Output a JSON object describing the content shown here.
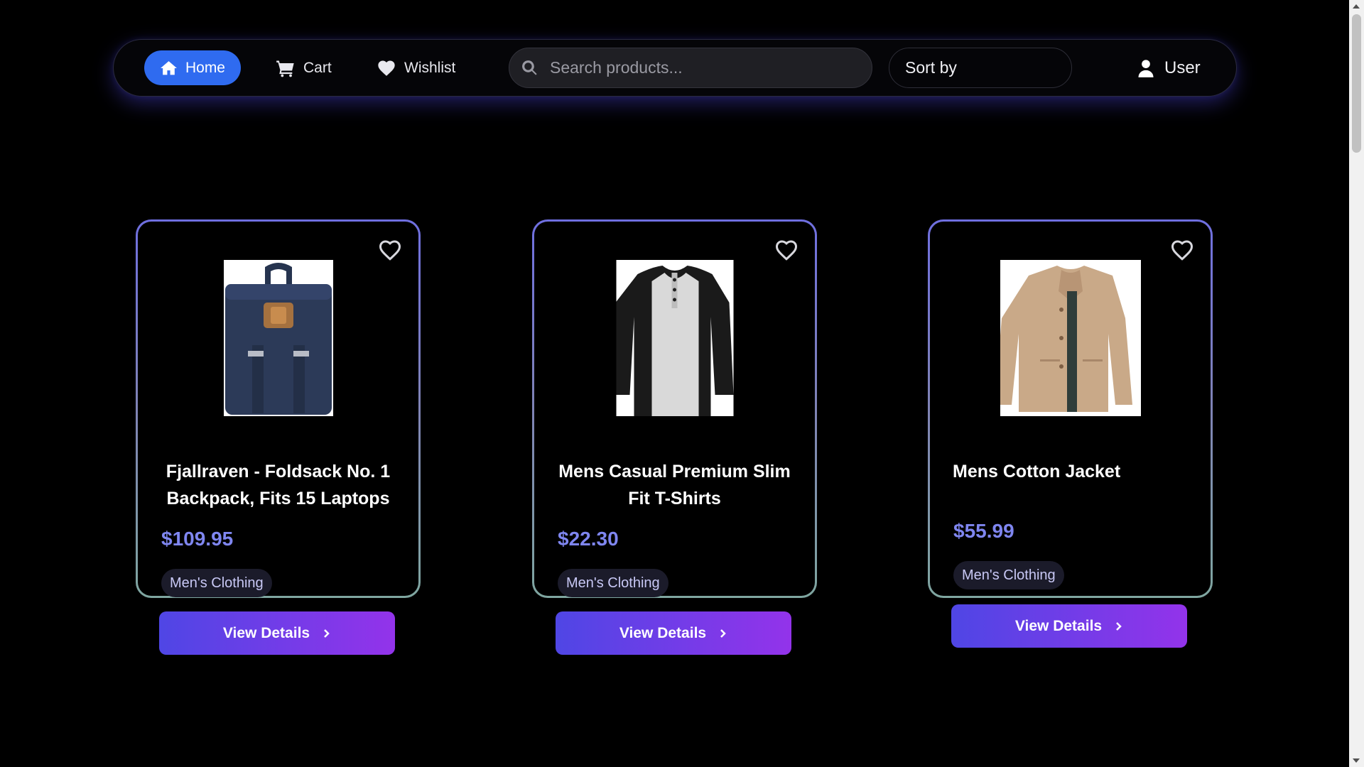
{
  "nav": {
    "home_label": "Home",
    "cart_label": "Cart",
    "wishlist_label": "Wishlist",
    "search_placeholder": "Search products...",
    "sort_label": "Sort by",
    "user_label": "User",
    "active_color": "#2f6bf0"
  },
  "products": [
    {
      "title": "Fjallraven - Foldsack No. 1 Backpack, Fits 15 Laptops",
      "price": "$109.95",
      "category": "Men's Clothing",
      "image": "backpack",
      "button": "View Details"
    },
    {
      "title": "Mens Casual Premium Slim Fit T-Shirts",
      "price": "$22.30",
      "category": "Men's Clothing",
      "image": "raglan-henley-shirt",
      "button": "View Details"
    },
    {
      "title": "Mens Cotton Jacket",
      "price": "$55.99",
      "category": "Men's Clothing",
      "image": "cotton-jacket",
      "button": "View Details"
    }
  ],
  "colors": {
    "price": "#7f86f0",
    "button_gradient_start": "#4f46e5",
    "button_gradient_end": "#9333ea"
  }
}
